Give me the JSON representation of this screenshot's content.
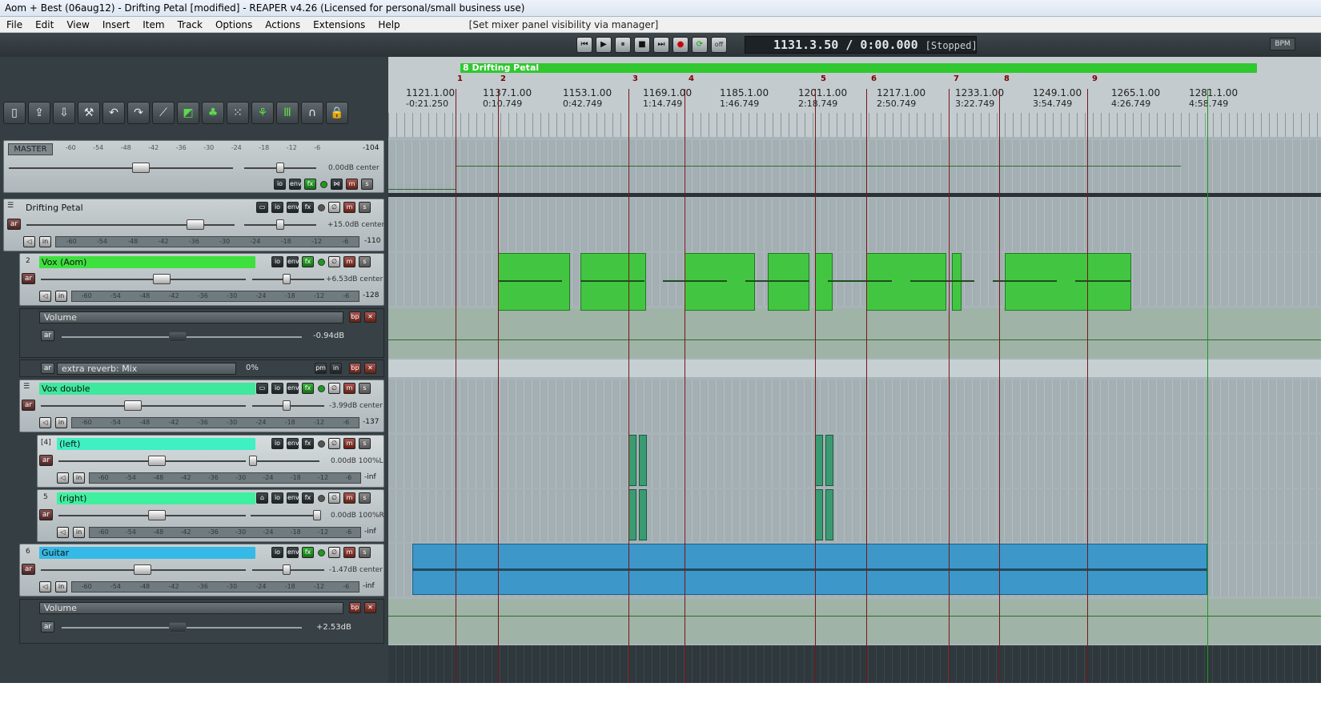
{
  "window": {
    "title": "Aom + Best (06aug12) - Drifting Petal [modified] - REAPER v4.26 (Licensed for personal/small business use)"
  },
  "menu": {
    "items": [
      "File",
      "Edit",
      "View",
      "Insert",
      "Item",
      "Track",
      "Options",
      "Actions",
      "Extensions",
      "Help"
    ],
    "extra": "[Set mixer panel visibility via manager]"
  },
  "transport": {
    "position": "1131.3.50 / 0:00.000",
    "state": "[Stopped]",
    "off_label": "off",
    "bpm_label": "BPM",
    "buttons": [
      "skip-start-icon",
      "play-icon",
      "pause-icon",
      "stop-icon",
      "skip-end-icon",
      "record-icon",
      "loop-icon"
    ]
  },
  "toolbar": {
    "icons": [
      "new-project-icon",
      "open-icon",
      "save-icon",
      "settings-icon",
      "undo-icon",
      "redo-icon",
      "metronome-icon",
      "snap-icon",
      "ripple-icon",
      "grid-icon",
      "env-lock-icon",
      "mixer-icon",
      "headphones-icon",
      "lock-icon"
    ]
  },
  "master": {
    "label": "MASTER",
    "meter_scale": [
      "-60",
      "-54",
      "-48",
      "-42",
      "-36",
      "-30",
      "-24",
      "-18",
      "-12",
      "-6"
    ],
    "meter_value": "-104",
    "volume": "0.00dB center",
    "buttons": {
      "io": "io",
      "env": "env",
      "fx": "fx",
      "m": "m",
      "s": "s"
    }
  },
  "tracks": [
    {
      "id": "1",
      "name": "Drifting Petal",
      "volume": "+15.0dB center",
      "meter_value": "-110",
      "color": "none"
    },
    {
      "id": "2",
      "name": "Vox (Aom)",
      "volume": "+6.53dB center",
      "meter_value": "-128",
      "color": "#3ee03e"
    },
    {
      "id": "3",
      "name": "Vox double",
      "volume": "-3.99dB center",
      "meter_value": "-137",
      "color": "#3ee89c"
    },
    {
      "id": "[4]",
      "name": "(left)",
      "volume": "0.00dB 100%L",
      "meter_value": "-inf",
      "color": "#3ef0c2"
    },
    {
      "id": "5",
      "name": "(right)",
      "volume": "0.00dB 100%R",
      "meter_value": "-inf",
      "color": "#3ef0a0"
    },
    {
      "id": "6",
      "name": "Guitar",
      "volume": "-1.47dB center",
      "meter_value": "-inf",
      "color": "#35b9e6"
    }
  ],
  "envelopes": {
    "vox_volume": {
      "label": "Volume",
      "value": "-0.94dB"
    },
    "vox_reverb": {
      "label": "extra reverb: Mix",
      "value": "0%"
    },
    "guitar_volume": {
      "label": "Volume",
      "value": "+2.53dB"
    }
  },
  "track_buttons": {
    "io": "io",
    "env": "env",
    "fx": "fx",
    "m": "m",
    "s": "s",
    "ar": "ar",
    "in": "in",
    "bp": "bp",
    "pm": "pm",
    "x": "✕"
  },
  "region": {
    "label": "8 Drifting Petal"
  },
  "markers": [
    "1",
    "2",
    "3",
    "4",
    "5",
    "6",
    "7",
    "8",
    "9"
  ],
  "timeline": [
    {
      "bar": "1121.1.00",
      "time": "-0:21.250"
    },
    {
      "bar": "1137.1.00",
      "time": "0:10.749"
    },
    {
      "bar": "1153.1.00",
      "time": "0:42.749"
    },
    {
      "bar": "1169.1.00",
      "time": "1:14.749"
    },
    {
      "bar": "1185.1.00",
      "time": "1:46.749"
    },
    {
      "bar": "1201.1.00",
      "time": "2:18.749"
    },
    {
      "bar": "1217.1.00",
      "time": "2:50.749"
    },
    {
      "bar": "1233.1.00",
      "time": "3:22.749"
    },
    {
      "bar": "1249.1.00",
      "time": "3:54.749"
    },
    {
      "bar": "1265.1.00",
      "time": "4:26.749"
    },
    {
      "bar": "1281.1.00",
      "time": "4:58.749"
    }
  ]
}
